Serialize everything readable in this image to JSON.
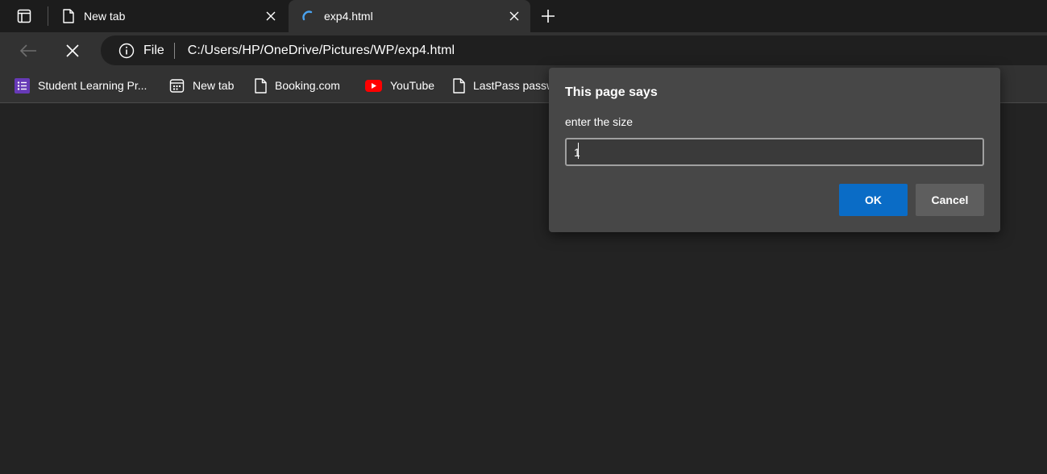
{
  "tabs": [
    {
      "title": "New tab",
      "icon": "page-icon",
      "active": false
    },
    {
      "title": "exp4.html",
      "icon": "loading-spinner-icon",
      "active": true
    }
  ],
  "toolbar": {
    "protocol_label": "File",
    "url": "C:/Users/HP/OneDrive/Pictures/WP/exp4.html"
  },
  "bookmarks": [
    {
      "label": "Student Learning Pr...",
      "icon": "forms-list-icon"
    },
    {
      "label": "New tab",
      "icon": "newtab-icon"
    },
    {
      "label": "Booking.com",
      "icon": "page-icon"
    },
    {
      "label": "YouTube",
      "icon": "youtube-icon"
    },
    {
      "label": "LastPass passw",
      "icon": "page-icon"
    }
  ],
  "dialog": {
    "heading": "This page says",
    "message": "enter the size",
    "input_value": "1",
    "ok_label": "OK",
    "cancel_label": "Cancel"
  },
  "colors": {
    "background": "#232323",
    "tab_strip": "#1c1c1c",
    "toolbar": "#323232",
    "dialog": "#474747",
    "ok_button": "#0a6cc6",
    "cancel_button": "#5e5e5e",
    "spinner": "#4aa3f0",
    "youtube_red": "#ff0000",
    "forms_purple": "#673ab7"
  }
}
